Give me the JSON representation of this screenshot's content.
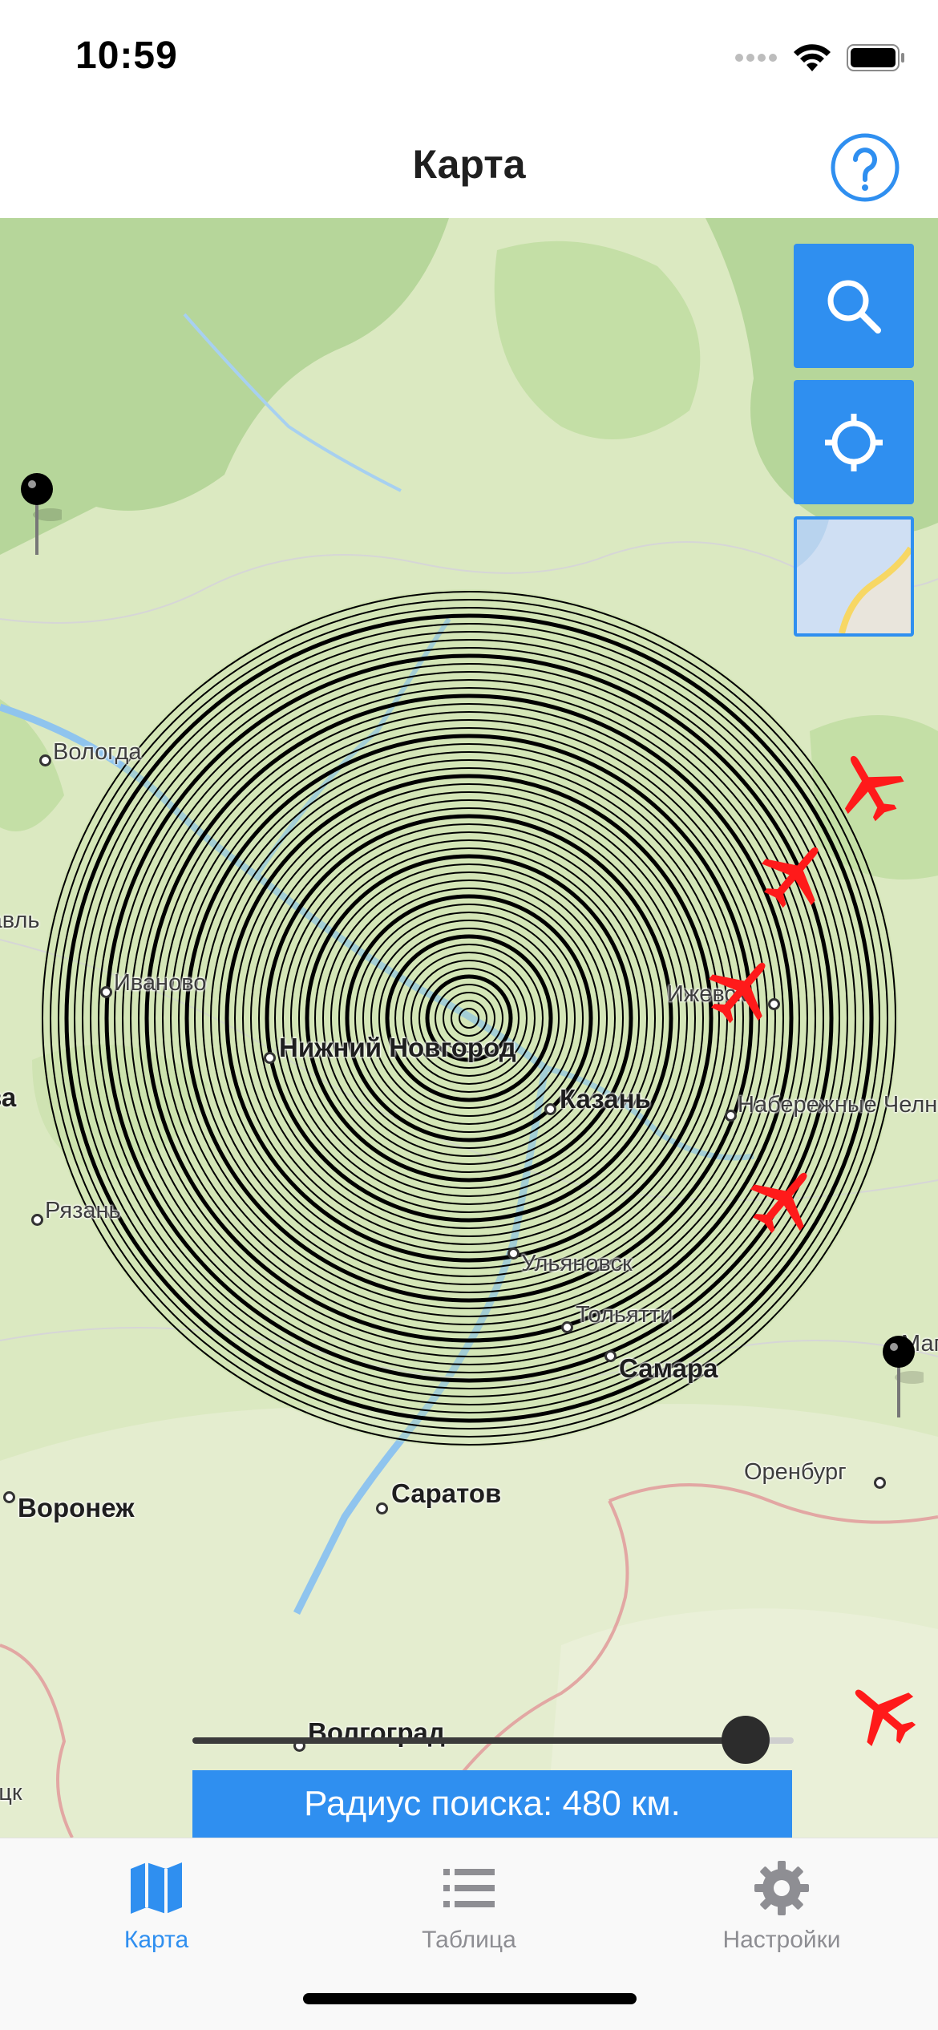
{
  "status_bar": {
    "time": "10:59"
  },
  "nav": {
    "title": "Карта",
    "help_icon": "question-circle-icon"
  },
  "map": {
    "cities": [
      {
        "name": "Вологда",
        "big": false
      },
      {
        "name": "Иваново",
        "big": false
      },
      {
        "name": "Нижний Новгород",
        "big": true
      },
      {
        "name": "Казань",
        "big": true
      },
      {
        "name": "Ижевск",
        "big": false
      },
      {
        "name": "Набережные Челны",
        "big": false
      },
      {
        "name": "Рязань",
        "big": false
      },
      {
        "name": "Ульяновск",
        "big": false
      },
      {
        "name": "Тольятти",
        "big": false
      },
      {
        "name": "Самара",
        "big": true
      },
      {
        "name": "Саратов",
        "big": true
      },
      {
        "name": "Воронеж",
        "big": true
      },
      {
        "name": "Оренбург",
        "big": false
      },
      {
        "name": "Волгоград",
        "big": true
      },
      {
        "name": "Москва",
        "big": true
      },
      {
        "name": "Ярославль",
        "big": false
      },
      {
        "name": "Донецк",
        "big": false
      },
      {
        "name": "Магнитогорск",
        "big": false
      }
    ],
    "buttons": {
      "search_icon": "search-icon",
      "locate_icon": "crosshair-icon",
      "map_type_icon": "map-thumbnail-icon"
    },
    "colors": {
      "accent": "#2f8ff0",
      "plane": "#ff1a1a",
      "rings": "#000000"
    }
  },
  "slider": {
    "value_fraction": 0.92
  },
  "radius": {
    "label": "Радиус поиска: 480 км."
  },
  "tabs": [
    {
      "label": "Карта",
      "icon": "map-icon",
      "active": true
    },
    {
      "label": "Таблица",
      "icon": "list-icon",
      "active": false
    },
    {
      "label": "Настройки",
      "icon": "gear-icon",
      "active": false
    }
  ]
}
